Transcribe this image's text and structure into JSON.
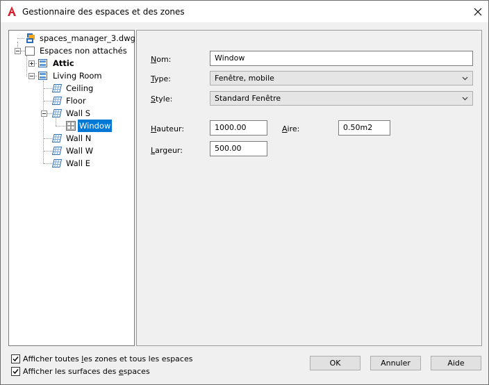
{
  "window": {
    "title": "Gestionnaire des espaces et des zones",
    "app_icon": "autocad-icon",
    "close_glyph": "✕"
  },
  "tree": {
    "root": "spaces_manager_3.dwg",
    "unattached": "Espaces non attachés",
    "attic": "Attic",
    "living_room": "Living Room",
    "ceiling": "Ceiling",
    "floor": "Floor",
    "wall_s": "Wall S",
    "window": "Window",
    "wall_n": "Wall N",
    "wall_w": "Wall W",
    "wall_e": "Wall E"
  },
  "props": {
    "nom_label_u": "N",
    "nom_label_rest": "om:",
    "nom_value": "Window",
    "type_label_u": "T",
    "type_label_rest": "ype:",
    "type_value": "Fenêtre, mobile",
    "style_label_u": "S",
    "style_label_rest": "tyle:",
    "style_value": "Standard Fenêtre",
    "hauteur_label_u": "H",
    "hauteur_label_rest": "auteur:",
    "hauteur_value": "1000.00",
    "aire_label_u": "A",
    "aire_label_rest": "ire:",
    "aire_value": "0.50m2",
    "largeur_label_u": "L",
    "largeur_label_rest": "argeur:",
    "largeur_value": "500.00"
  },
  "options": {
    "show_all_pre": "Afficher toutes ",
    "show_all_u": "l",
    "show_all_post": "es zones et tous les espaces",
    "show_all_checked": true,
    "show_surfaces_pre": "Afficher les surfaces des ",
    "show_surfaces_u": "e",
    "show_surfaces_post": "spaces",
    "show_surfaces_checked": true
  },
  "buttons": {
    "ok": "OK",
    "cancel": "Annuler",
    "help": "Aide"
  }
}
